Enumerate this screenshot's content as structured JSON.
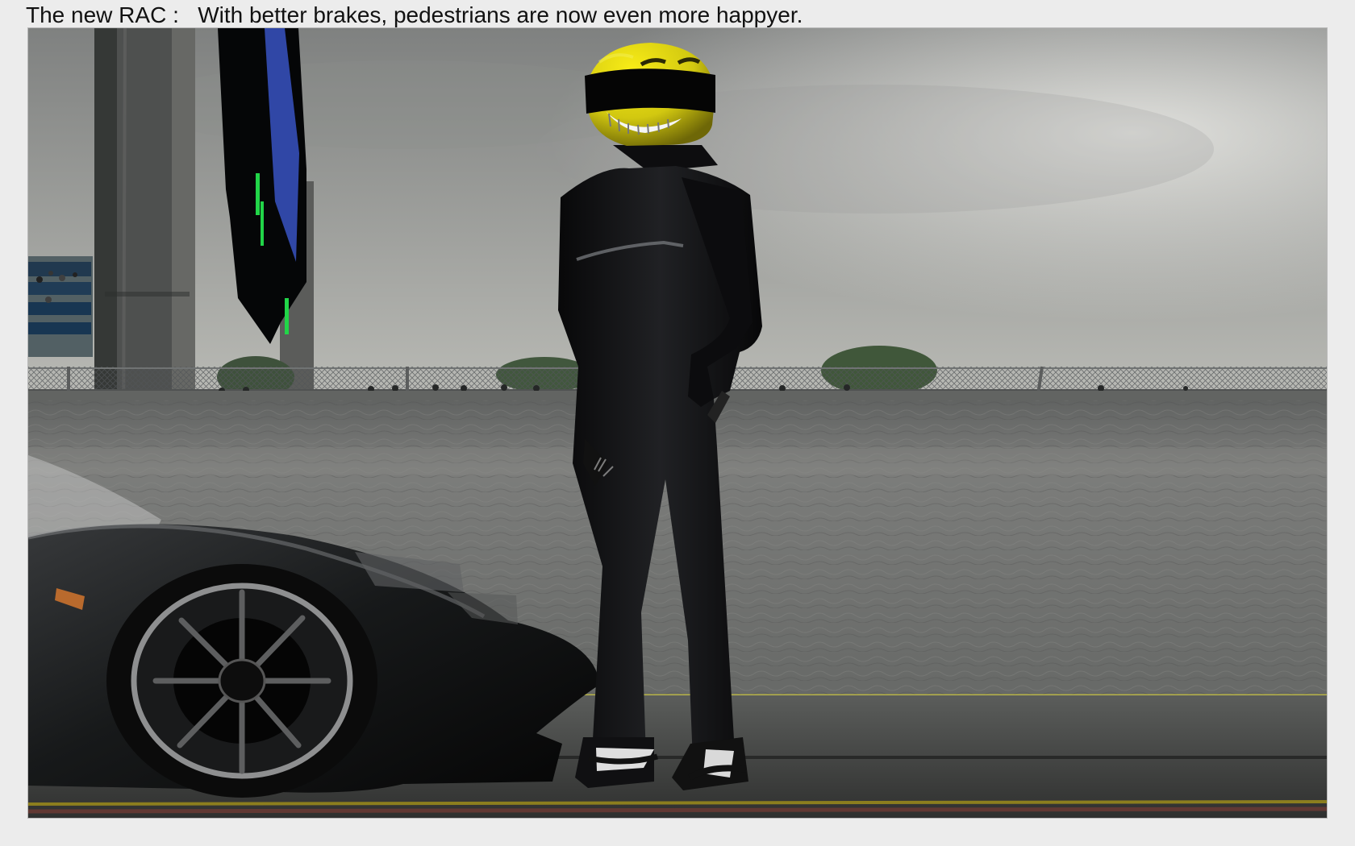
{
  "caption": {
    "prefix": "The new RAC :",
    "text": "With better brakes, pedestrians are now even more happyer."
  },
  "scene": {
    "colors": {
      "page_background": "#ececec",
      "sky_top": "#7f8180",
      "sky_bottom": "#d8d8d0",
      "wall": "#747573",
      "helmet": "#d7cf11",
      "suit": "#151516",
      "green_lights": "#21d548",
      "blue_sign": "#3047a6"
    },
    "icons": [
      "pit-tower",
      "timing-sign",
      "spectator-grandstand",
      "safety-fence",
      "race-car",
      "driver-figure",
      "smiley-helmet"
    ]
  }
}
